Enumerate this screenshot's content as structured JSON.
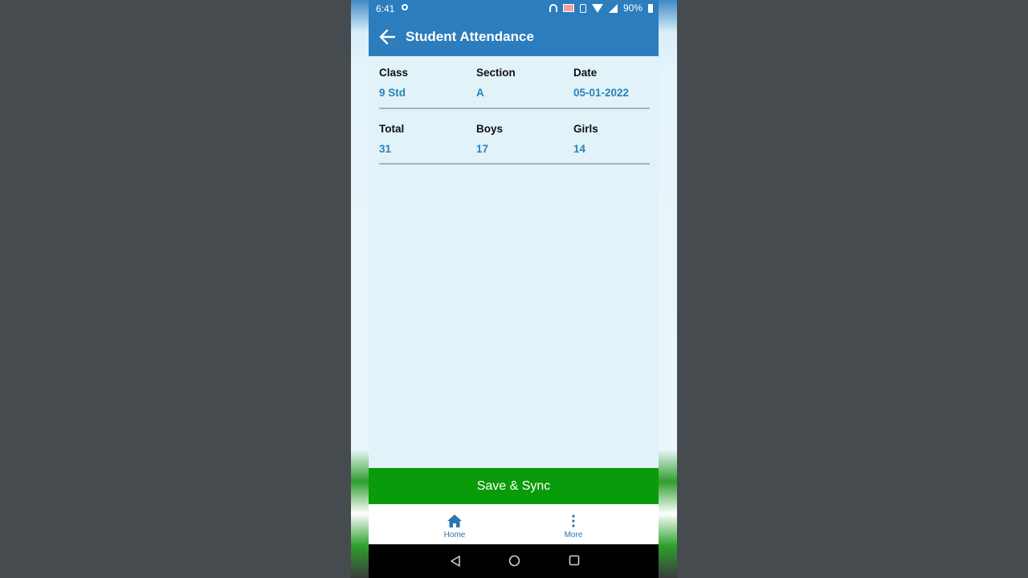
{
  "status_bar": {
    "time": "6:41",
    "battery": "90%",
    "icons": [
      "record-icon",
      "headphones-icon",
      "cast-icon",
      "vibrate-icon",
      "wifi-icon",
      "signal-icon",
      "battery-icon"
    ]
  },
  "app_bar": {
    "title": "Student Attendance",
    "back_icon": "arrow-left-icon",
    "color": "#2c7dbd"
  },
  "summary": {
    "class_label": "Class",
    "class_value": "9 Std",
    "section_label": "Section",
    "section_value": "A",
    "date_label": "Date",
    "date_value": "05-01-2022",
    "total_label": "Total",
    "total_value": "31",
    "boys_label": "Boys",
    "boys_value": "17",
    "girls_label": "Girls",
    "girls_value": "14"
  },
  "actions": {
    "save_label": "Save & Sync",
    "save_color": "#0a9b0a"
  },
  "bottom_nav": {
    "items": [
      {
        "label": "Home",
        "icon": "home-icon"
      },
      {
        "label": "More",
        "icon": "more-vertical-icon"
      }
    ]
  },
  "system_nav": {
    "icons": [
      "back-triangle-icon",
      "home-circle-icon",
      "recents-square-icon"
    ]
  },
  "colors": {
    "background": "#e1f3f9",
    "value_text": "#2a82b8"
  }
}
